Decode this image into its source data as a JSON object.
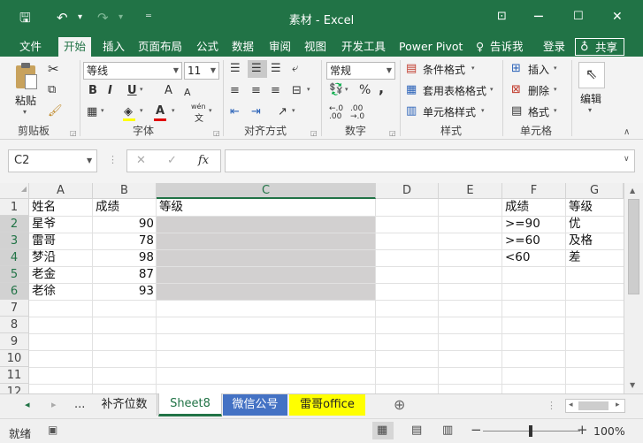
{
  "window": {
    "title": "素材 - Excel",
    "controls": {
      "minimize": "─",
      "restore": "☐",
      "close": "✕",
      "ribbon_options": "⊡"
    }
  },
  "qat": {
    "save": "🖫",
    "undo": "↶",
    "undo_dd": "▾",
    "redo": "↷",
    "redo_dd": "▾",
    "customize": "⁼"
  },
  "tabs": [
    "文件",
    "开始",
    "插入",
    "页面布局",
    "公式",
    "数据",
    "审阅",
    "视图",
    "开发工具",
    "Power Pivot"
  ],
  "tell_me": "告诉我",
  "tell_me_icon": "♀",
  "login": "登录",
  "share": "共享",
  "share_icon": "♁",
  "ribbon": {
    "groups": [
      "剪贴板",
      "字体",
      "对齐方式",
      "数字",
      "样式",
      "单元格",
      "编辑"
    ],
    "paste": "粘贴",
    "font_name": "等线",
    "font_size": "11",
    "number_format": "常规",
    "bold": "B",
    "italic": "I",
    "underline": "U",
    "grow_font": "A",
    "shrink_font": "A",
    "font_color": "A",
    "wen": "wén",
    "wen_char": "文",
    "percent": "%",
    "comma": ",",
    "styles": [
      "条件格式",
      "套用表格格式",
      "单元格样式"
    ],
    "cells": [
      "插入",
      "删除",
      "格式"
    ],
    "edit": "编辑"
  },
  "formula_bar": {
    "namebox": "C2",
    "fx": "fx",
    "cancel": "✕",
    "enter": "✓",
    "value": ""
  },
  "grid": {
    "columns": [
      "A",
      "B",
      "C",
      "D",
      "E",
      "F",
      "G"
    ],
    "rows": [
      "1",
      "2",
      "3",
      "4",
      "5",
      "6",
      "7",
      "8",
      "9",
      "10",
      "11",
      "12"
    ],
    "cells": {
      "A1": "姓名",
      "B1": "成绩",
      "C1": "等级",
      "F1": "成绩",
      "G1": "等级",
      "A2": "星爷",
      "B2": "90",
      "F2": ">=90",
      "G2": "优",
      "A3": "雷哥",
      "B3": "78",
      "F3": ">=60",
      "G3": "及格",
      "A4": "梦沿",
      "B4": "98",
      "F4": "<60",
      "G4": "差",
      "A5": "老金",
      "B5": "87",
      "A6": "老徐",
      "B6": "93"
    },
    "selection_fill": "#d2d0d0"
  },
  "sheets": {
    "nav_prev": "◂",
    "nav_next": "▸",
    "more": "...",
    "tabs": [
      {
        "name": "补齐位数",
        "bg": "#f0f0f0",
        "color": "#222"
      },
      {
        "name": "Sheet8",
        "bg": "#ffffff",
        "color": "#217346"
      },
      {
        "name": "微信公号",
        "bg": "#4472c4",
        "color": "#ffffff"
      },
      {
        "name": "雷哥office",
        "bg": "#ffff00",
        "color": "#222222"
      }
    ],
    "add": "⊕"
  },
  "status": {
    "ready": "就绪",
    "zoom": "100%",
    "minus": "−",
    "plus": "+"
  },
  "colors": {
    "excel_green": "#217346",
    "ribbon_bg": "#f3f3f3"
  }
}
